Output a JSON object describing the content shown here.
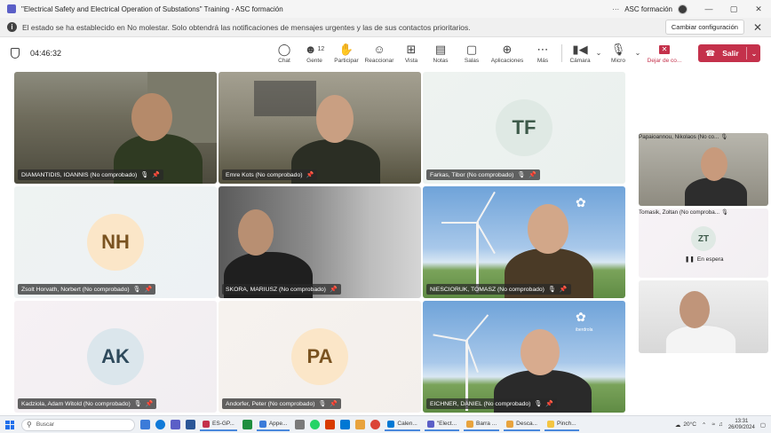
{
  "window": {
    "title": "\"Electrical Safety and Electrical Operation of Substations\" Training - ASC formación",
    "more": "···",
    "org": "ASC formación",
    "minimize": "—",
    "maximize": "▢",
    "close": "✕"
  },
  "banner": {
    "message": "El estado se ha establecido en No molestar. Solo obtendrá las notificaciones de mensajes urgentes y las de sus contactos prioritarios.",
    "config_button": "Cambiar configuración",
    "close": "✕"
  },
  "toolbar": {
    "timer": "04:46:32",
    "chat": "Chat",
    "people": "Gente",
    "people_count": "12",
    "raise": "Participar",
    "react": "Reaccionar",
    "view": "Vista",
    "notes": "Notas",
    "rooms": "Salas",
    "apps": "Aplicaciones",
    "more": "Más",
    "camera": "Cámara",
    "mic": "Micro",
    "share": "Dejar de co...",
    "leave": "Salir"
  },
  "tiles": [
    {
      "name": "DIAMANTIDIS, IOANNIS (No comprobado)"
    },
    {
      "name": "Emre Kots (No comprobado)"
    },
    {
      "name": "Farkas, Tibor (No comprobado)",
      "initials": "TF"
    },
    {
      "name": "Zsolt Horvath, Norbert (No comprobado)",
      "initials": "NH"
    },
    {
      "name": "SKORA, MARIUSZ (No comprobado)"
    },
    {
      "name": "NIESCIORUK, TOMASZ (No comprobado)"
    },
    {
      "name": "Kadziola, Adam Witold (No comprobado)",
      "initials": "AK"
    },
    {
      "name": "Andorfer, Peter (No comprobado)",
      "initials": "PA"
    },
    {
      "name": "EICHNER, DANIEL (No comprobado)"
    }
  ],
  "side_tiles": [
    {
      "name": "Papaioannou, Nikolaos (No co..."
    },
    {
      "name": "Tomasik, Zoltan (No comproba...",
      "initials": "ZT",
      "status": "En espera"
    },
    {
      "name": ""
    }
  ],
  "brand_logo": "iberdrola",
  "taskbar": {
    "search": "Buscar",
    "apps": [
      "ES-GP...",
      "Appe...",
      "Calen...",
      "\"Elect...",
      "Barra ...",
      "Desca...",
      "Pinch..."
    ],
    "weather": "20°C",
    "time": "13:31",
    "date": "26/09/2024"
  },
  "colors": {
    "accent": "#5b5fc7",
    "leave": "#c4314b",
    "initials_text": "#3d5a4a"
  }
}
